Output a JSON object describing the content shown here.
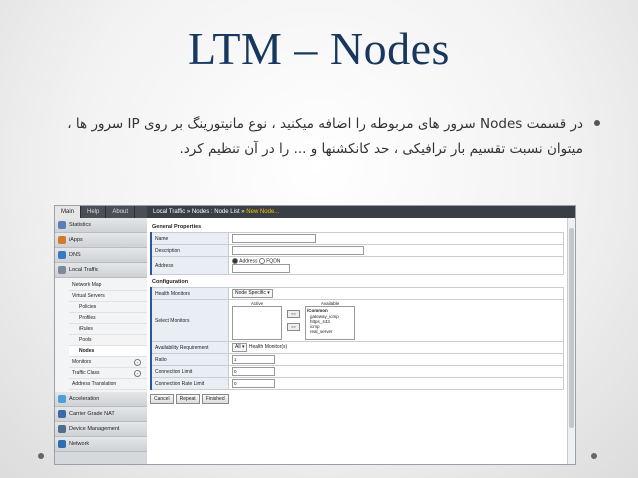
{
  "slide": {
    "title": "LTM – Nodes",
    "bullet_line1": "در قسمت Nodes سرور های مربوطه را اضافه میکنید ، نوع مانیتورینگ بر روی IP سرور ها ،",
    "bullet_line2": "میتوان نسبت تقسیم بار ترافیکی ، حد کانکشنها و ... را در آن تنظیم کرد."
  },
  "nav_tabs": [
    "Main",
    "Help",
    "About"
  ],
  "breadcrumb": {
    "part1": "Local Traffic",
    "sep": " » ",
    "part2": "Nodes : Node List",
    "part3": "New Node..."
  },
  "sidebar": {
    "top_items": [
      {
        "label": "Statistics",
        "color": "#5b7fb5"
      },
      {
        "label": "iApps",
        "color": "#d07a2a"
      },
      {
        "label": "DNS",
        "color": "#3a78c2"
      },
      {
        "label": "Local Traffic",
        "color": "#7a8b9c"
      }
    ],
    "sub_items": [
      {
        "label": "Network Map",
        "level": 1
      },
      {
        "label": "Virtual Servers",
        "level": 1
      },
      {
        "label": "Policies",
        "level": 2
      },
      {
        "label": "Profiles",
        "level": 2
      },
      {
        "label": "iRules",
        "level": 2
      },
      {
        "label": "Pools",
        "level": 2
      },
      {
        "label": "Nodes",
        "level": 2,
        "selected": true
      },
      {
        "label": "Monitors",
        "level": 1,
        "plus": true
      },
      {
        "label": "Traffic Class",
        "level": 1,
        "plus": true
      },
      {
        "label": "Address Translation",
        "level": 1
      }
    ],
    "bottom_items": [
      {
        "label": "Acceleration",
        "color": "#4aa0d8"
      },
      {
        "label": "Carrier Grade NAT",
        "color": "#3a6aa8"
      },
      {
        "label": "Device Management",
        "color": "#4f6e8e"
      },
      {
        "label": "Network",
        "color": "#2f6fb0"
      }
    ]
  },
  "general": {
    "title": "General Properties",
    "name_label": "Name",
    "description_label": "Description",
    "address_label": "Address",
    "radio_address": "Address",
    "radio_fqdn": "FQDN"
  },
  "config": {
    "title": "Configuration",
    "health_label": "Health Monitors",
    "health_value": "Node Specific",
    "select_label": "Select Monitors",
    "active_header": "Active",
    "available_header": "Available",
    "available_list": [
      "/Common",
      "gateway_icmp",
      "https_443",
      "icmp",
      "real_server"
    ],
    "move_left": "<<",
    "move_right": ">>",
    "availability_label": "Availability Requirement",
    "availability_value": "All",
    "availability_suffix": "Health Monitor(s)",
    "ratio_label": "Ratio",
    "ratio_value": "1",
    "conn_limit_label": "Connection Limit",
    "conn_limit_value": "0",
    "conn_rate_label": "Connection Rate Limit",
    "conn_rate_value": "0"
  },
  "buttons": {
    "cancel": "Cancel",
    "repeat": "Repeat",
    "finished": "Finished"
  }
}
